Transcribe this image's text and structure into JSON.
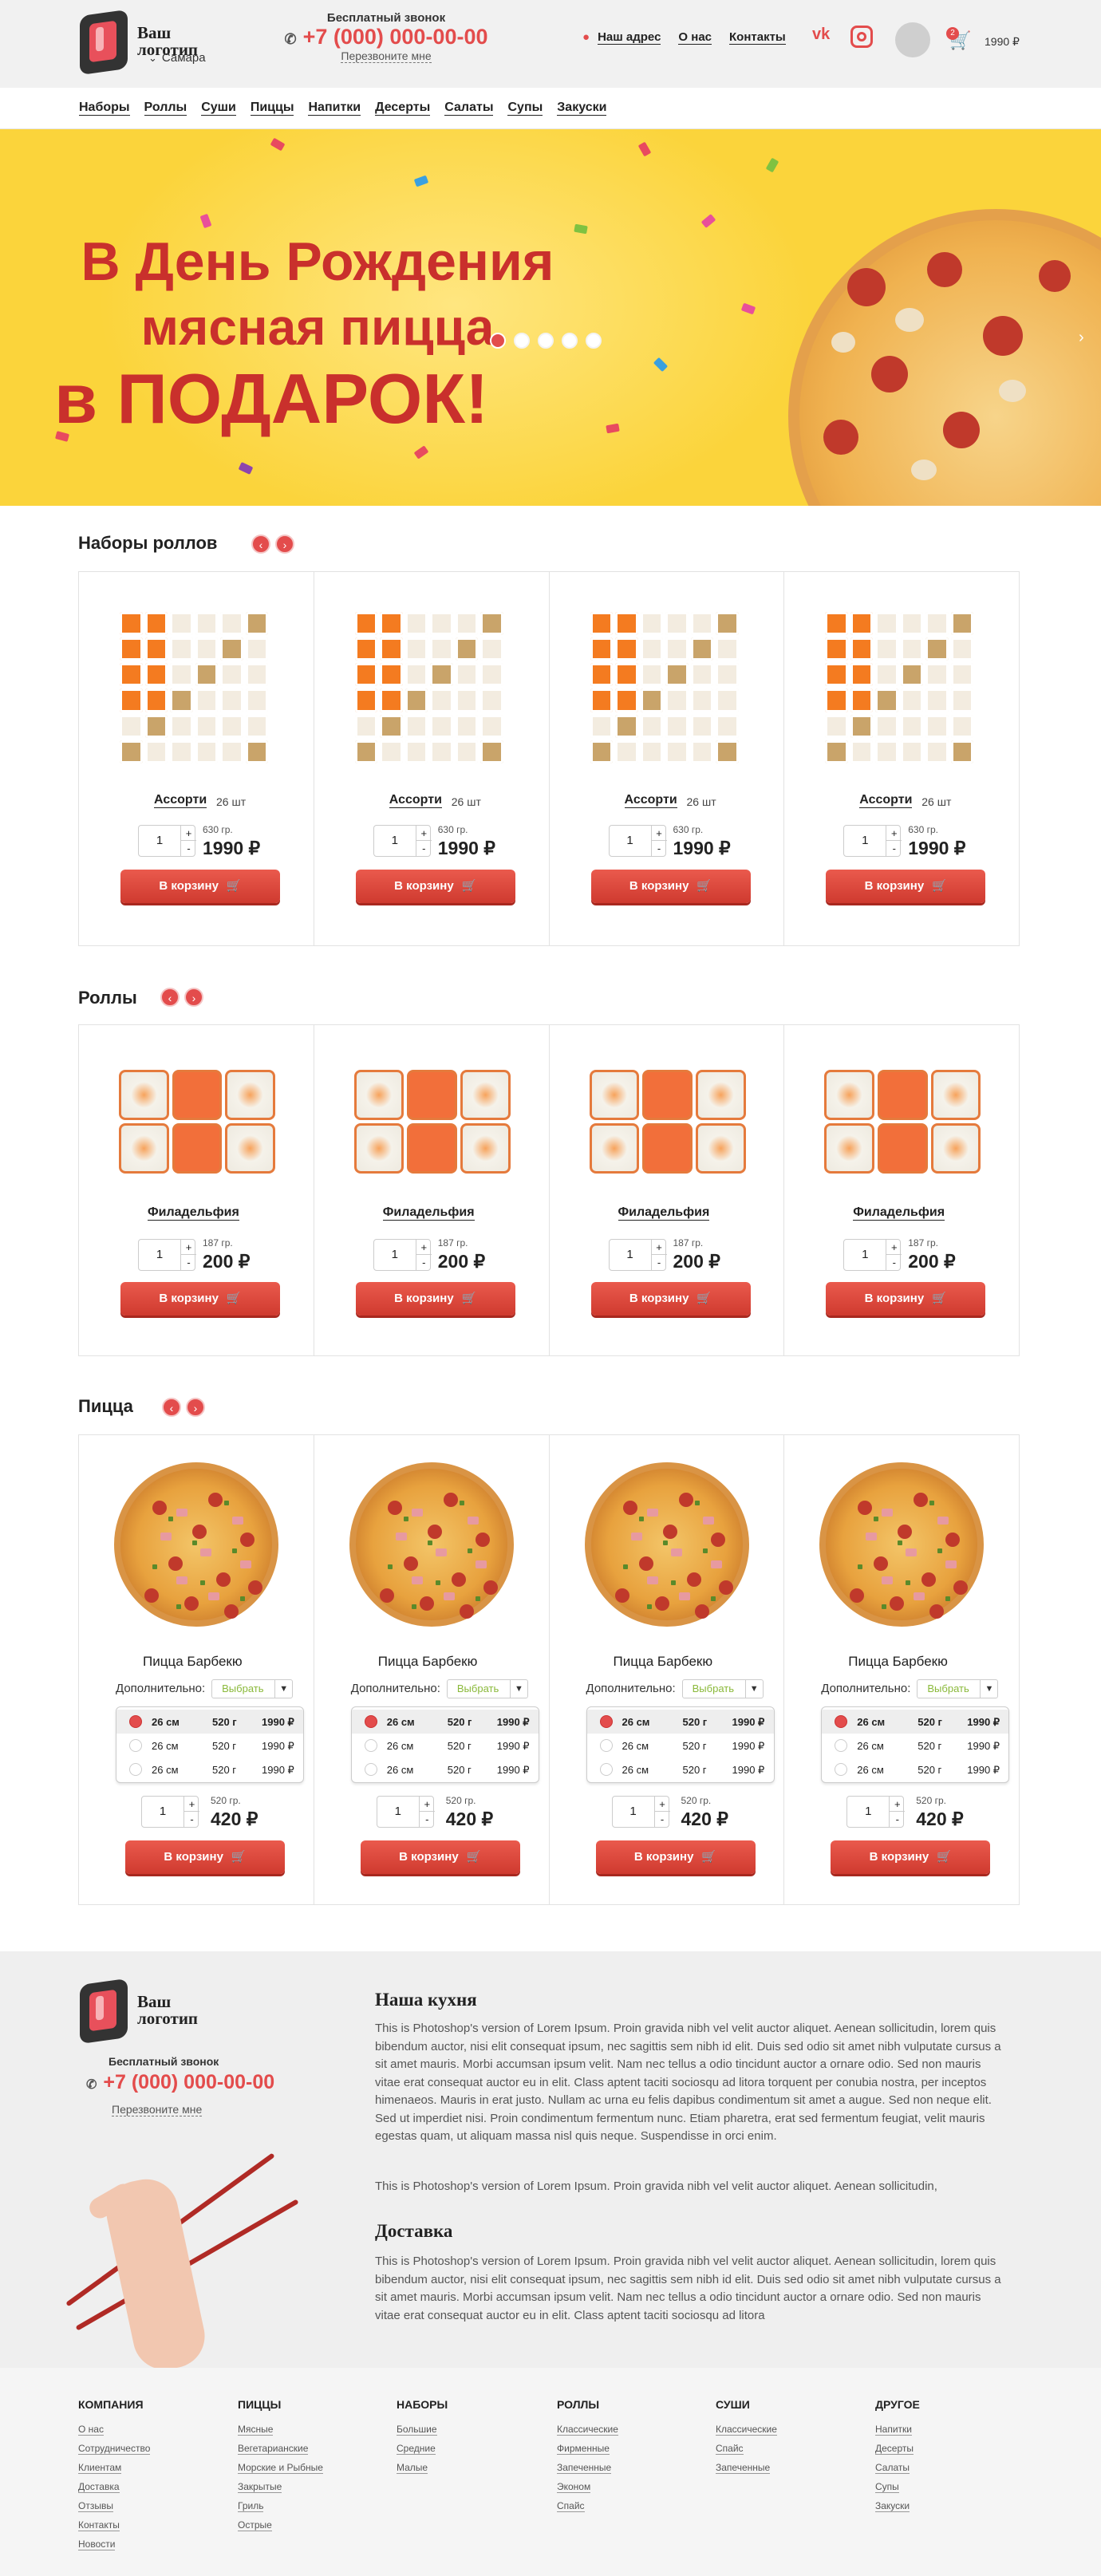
{
  "header": {
    "logo": "Ваш логотип",
    "logo_line1": "Ваш",
    "logo_line2": "логотип",
    "city": "Самара",
    "phone_caption": "Бесплатный звонок",
    "phone": "+7 (000) 000-00-00",
    "callback": "Перезвоните мне",
    "links": [
      "Наш адрес",
      "О нас",
      "Контакты"
    ],
    "social": [
      "vk-icon",
      "instagram-icon"
    ],
    "cart_count": "2",
    "cart_total": "1990 ₽"
  },
  "menu": [
    "Наборы",
    "Роллы",
    "Суши",
    "Пиццы",
    "Напитки",
    "Десерты",
    "Салаты",
    "Супы",
    "Закуски"
  ],
  "banner": {
    "line1": "В День Рождения",
    "line2": "мясная пицца",
    "line3": "в ПОДАРОК!",
    "slide_count": 5,
    "active_slide": 1
  },
  "sets": {
    "title": "Наборы роллов",
    "items": [
      {
        "name": "Ассорти",
        "count": "26 шт",
        "weight": "630 гр.",
        "price": "1990 ₽",
        "qty": "1",
        "button": "В корзину"
      },
      {
        "name": "Ассорти",
        "count": "26 шт",
        "weight": "630 гр.",
        "price": "1990 ₽",
        "qty": "1",
        "button": "В корзину"
      },
      {
        "name": "Ассорти",
        "count": "26 шт",
        "weight": "630 гр.",
        "price": "1990 ₽",
        "qty": "1",
        "button": "В корзину"
      },
      {
        "name": "Ассорти",
        "count": "26 шт",
        "weight": "630 гр.",
        "price": "1990 ₽",
        "qty": "1",
        "button": "В корзину"
      }
    ]
  },
  "rolls": {
    "title": "Роллы",
    "items": [
      {
        "name": "Филадельфия",
        "weight": "187 гр.",
        "price": "200 ₽",
        "qty": "1",
        "button": "В корзину"
      },
      {
        "name": "Филадельфия",
        "weight": "187 гр.",
        "price": "200 ₽",
        "qty": "1",
        "button": "В корзину"
      },
      {
        "name": "Филадельфия",
        "weight": "187 гр.",
        "price": "200 ₽",
        "qty": "1",
        "button": "В корзину"
      },
      {
        "name": "Филадельфия",
        "weight": "187 гр.",
        "price": "200 ₽",
        "qty": "1",
        "button": "В корзину"
      }
    ]
  },
  "pizza": {
    "title": "Пицца",
    "extra_label": "Дополнительно:",
    "extra_select": "Выбрать",
    "sizes": [
      {
        "size": "26 см",
        "weight": "520 г",
        "price": "1990 ₽",
        "selected": true
      },
      {
        "size": "26 см",
        "weight": "520 г",
        "price": "1990 ₽",
        "selected": false
      },
      {
        "size": "26 см",
        "weight": "520 г",
        "price": "1990 ₽",
        "selected": false
      }
    ],
    "items": [
      {
        "name": "Пицца Барбекю",
        "weight": "520 гр.",
        "price": "420 ₽",
        "qty": "1",
        "button": "В корзину"
      },
      {
        "name": "Пицца Барбекю",
        "weight": "520 гр.",
        "price": "420 ₽",
        "qty": "1",
        "button": "В корзину"
      },
      {
        "name": "Пицца Барбекю",
        "weight": "520 гр.",
        "price": "420 ₽",
        "qty": "1",
        "button": "В корзину"
      },
      {
        "name": "Пицца Барбекю",
        "weight": "520 гр.",
        "price": "420 ₽",
        "qty": "1",
        "button": "В корзину"
      }
    ]
  },
  "about": {
    "kitchen_title": "Наша кухня",
    "kitchen_p1": "This is Photoshop's version  of Lorem Ipsum. Proin gravida nibh vel velit auctor aliquet. Aenean sollicitudin, lorem quis bibendum auctor, nisi elit consequat ipsum, nec sagittis sem nibh id elit. Duis sed odio sit amet nibh vulputate cursus a sit amet mauris. Morbi accumsan ipsum velit. Nam nec tellus a odio tincidunt auctor a ornare odio. Sed non  mauris vitae erat consequat auctor eu in elit. Class aptent taciti sociosqu ad litora torquent per conubia nostra, per inceptos himenaeos. Mauris in erat justo. Nullam ac urna eu felis dapibus condimentum sit amet a augue. Sed non neque elit. Sed ut imperdiet nisi. Proin condimentum fermentum nunc. Etiam pharetra, erat sed fermentum feugiat, velit mauris egestas quam, ut aliquam massa nisl quis neque. Suspendisse in orci enim.",
    "kitchen_p2": "This is Photoshop's version  of Lorem Ipsum. Proin gravida nibh vel velit auctor aliquet. Aenean sollicitudin,",
    "delivery_title": "Доставка",
    "delivery_p": "This is Photoshop's version  of Lorem Ipsum. Proin gravida nibh vel velit auctor aliquet. Aenean sollicitudin, lorem quis bibendum auctor, nisi elit consequat ipsum, nec sagittis sem nibh id elit. Duis sed odio sit amet nibh vulputate cursus a sit amet mauris. Morbi accumsan ipsum velit. Nam nec tellus a odio tincidunt auctor a ornare odio. Sed non  mauris vitae erat consequat auctor eu in elit. Class aptent taciti sociosqu ad litora"
  },
  "footer": {
    "columns": [
      {
        "title": "КОМПАНИЯ",
        "links": [
          "О нас",
          "Сотрудничество",
          "Клиентам",
          "Доставка",
          "Отзывы",
          "Контакты",
          "Новости"
        ]
      },
      {
        "title": "ПИЦЦЫ",
        "links": [
          "Мясные",
          "Вегетарианские",
          "Морские и Рыбные",
          "Закрытые",
          "Гриль",
          "Острые"
        ]
      },
      {
        "title": "НАБОРЫ",
        "links": [
          "Большие",
          "Средние",
          "Малые"
        ]
      },
      {
        "title": "РОЛЛЫ",
        "links": [
          "Классические",
          "Фирменные",
          "Запеченные",
          "Эконом",
          "Спайс"
        ]
      },
      {
        "title": "СУШИ",
        "links": [
          "Классические",
          "Спайс",
          "Запеченные"
        ]
      },
      {
        "title": "ДРУГОЕ",
        "links": [
          "Напитки",
          "Десерты",
          "Салаты",
          "Супы",
          "Закуски"
        ]
      }
    ]
  },
  "colors": {
    "accent": "#e34c4c",
    "banner_bg": "#fbd43b",
    "banner_text": "#c9302c",
    "select_text": "#8ab93a"
  }
}
